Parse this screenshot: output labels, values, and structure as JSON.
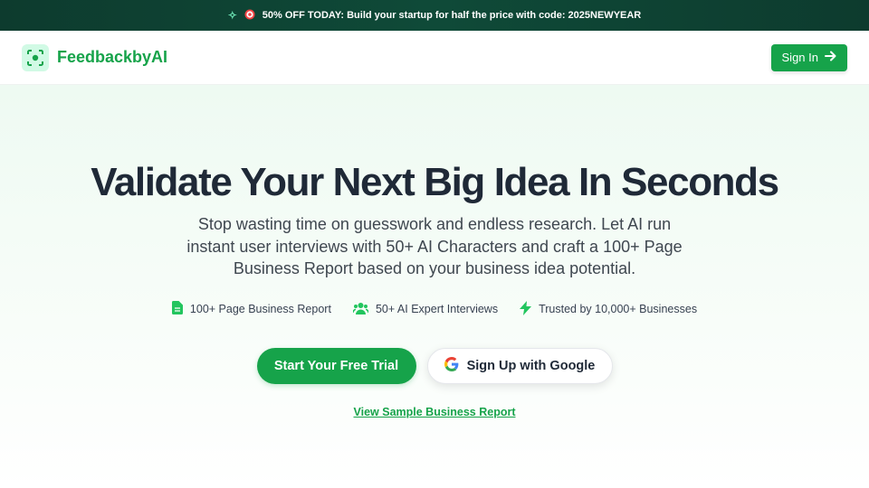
{
  "promo": {
    "sparkle_icon": "sparkle-icon",
    "target_icon": "target-icon",
    "text": "50% OFF TODAY: Build your startup for half the price with code: 2025NEWYEAR"
  },
  "header": {
    "brand_name": "FeedbackbyAI",
    "logo_icon": "scan-focus-icon",
    "signin_label": "Sign In",
    "signin_icon": "arrow-right-icon"
  },
  "hero": {
    "title": "Validate Your Next Big Idea In Seconds",
    "subtitle": "Stop wasting time on guesswork and endless research. Let AI run instant user interviews with 50+ AI Characters and craft a 100+ Page Business Report based on your business idea potential.",
    "features": [
      {
        "icon": "document-icon",
        "label": "100+ Page Business Report"
      },
      {
        "icon": "users-icon",
        "label": "50+ AI Expert Interviews"
      },
      {
        "icon": "lightning-icon",
        "label": "Trusted by 10,000+ Businesses"
      }
    ],
    "primary_cta": "Start Your Free Trial",
    "google_cta": "Sign Up with Google",
    "sample_link": "View Sample Business Report"
  },
  "colors": {
    "accent": "#16a34a",
    "promo_bg": "#0d3b2e",
    "hero_bg": "#eefaf2"
  }
}
